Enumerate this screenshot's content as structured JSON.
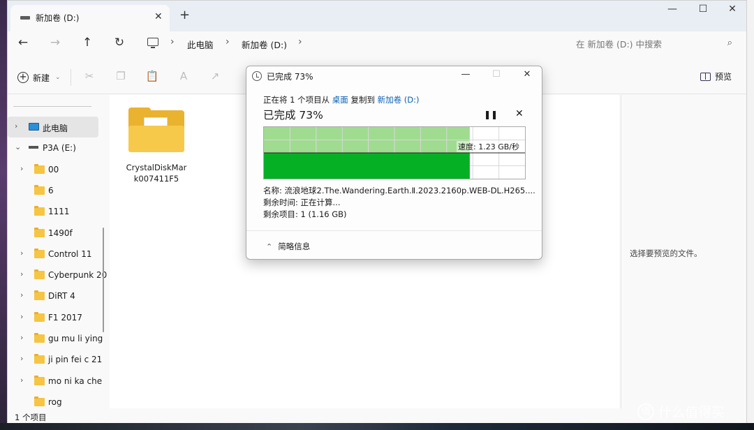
{
  "window": {
    "tab_title": "新加卷 (D:)",
    "tab_close_icon": "✕",
    "new_tab_icon": "+",
    "minimize": "—",
    "maximize": "☐",
    "close": "✕"
  },
  "nav": {
    "back": "←",
    "forward": "→",
    "up": "↑",
    "refresh": "↻",
    "breadcrumb": [
      "此电脑",
      "新加卷 (D:)"
    ],
    "sep": "›",
    "search_placeholder": "在 新加卷 (D:) 中搜索",
    "search_icon": "⌕"
  },
  "cmdbar": {
    "new_label": "新建",
    "new_chevron": "⌄",
    "preview_label": "预览",
    "icons": [
      "✂",
      "❐",
      "📋",
      "A",
      "↗"
    ]
  },
  "sidebar": {
    "items": [
      {
        "label": "此电脑",
        "type": "pc",
        "level": 0,
        "chev": "›"
      },
      {
        "label": "P3A (E:)",
        "type": "drive",
        "level": 0,
        "chev": "⌄"
      },
      {
        "label": "00",
        "type": "folder",
        "level": 1,
        "chev": "›"
      },
      {
        "label": "6",
        "type": "folder",
        "level": 1,
        "chev": ""
      },
      {
        "label": "1111",
        "type": "folder",
        "level": 1,
        "chev": ""
      },
      {
        "label": "1490f",
        "type": "folder",
        "level": 1,
        "chev": ""
      },
      {
        "label": "Control 11",
        "type": "folder",
        "level": 1,
        "chev": "›"
      },
      {
        "label": "Cyberpunk 20",
        "type": "folder",
        "level": 1,
        "chev": "›"
      },
      {
        "label": "DiRT 4",
        "type": "folder",
        "level": 1,
        "chev": "›"
      },
      {
        "label": "F1 2017",
        "type": "folder",
        "level": 1,
        "chev": "›"
      },
      {
        "label": "gu mu li ying",
        "type": "folder",
        "level": 1,
        "chev": "›"
      },
      {
        "label": "ji pin fei c 21",
        "type": "folder",
        "level": 1,
        "chev": "›"
      },
      {
        "label": "mo ni ka che",
        "type": "folder",
        "level": 1,
        "chev": "›"
      },
      {
        "label": "rog",
        "type": "folder",
        "level": 1,
        "chev": ""
      }
    ]
  },
  "content": {
    "file_name": "CrystalDiskMark007411F5"
  },
  "preview_pane": {
    "message": "选择要预览的文件。"
  },
  "status": {
    "count": "1 个项目"
  },
  "dialog": {
    "title": "已完成 73%",
    "line1_prefix": "正在将 1 个项目从 ",
    "source": "桌面",
    "line1_mid": " 复制到 ",
    "dest": "新加卷 (D:)",
    "headline": "已完成 73%",
    "pause_icon": "❚❚",
    "stop_icon": "✕",
    "speed": "速度: 1.23 GB/秒",
    "progress_fraction": 0.73,
    "name_line": "名称: 流浪地球2.The.Wandering.Earth.Ⅱ.2023.2160p.WEB-DL.H265....",
    "time_line": "剩余时间: 正在计算...",
    "items_line": "剩余项目: 1 (1.16 GB)",
    "more_label": "简略信息",
    "more_chev": "⌃",
    "minimize": "—",
    "maximize": "☐",
    "close": "✕",
    "colors": {
      "fill_light": "#9fdc90",
      "fill_dark": "#06b025",
      "grid": "#d8d8d8"
    }
  },
  "watermark": {
    "glyph": "值",
    "text": "什么值得买"
  }
}
